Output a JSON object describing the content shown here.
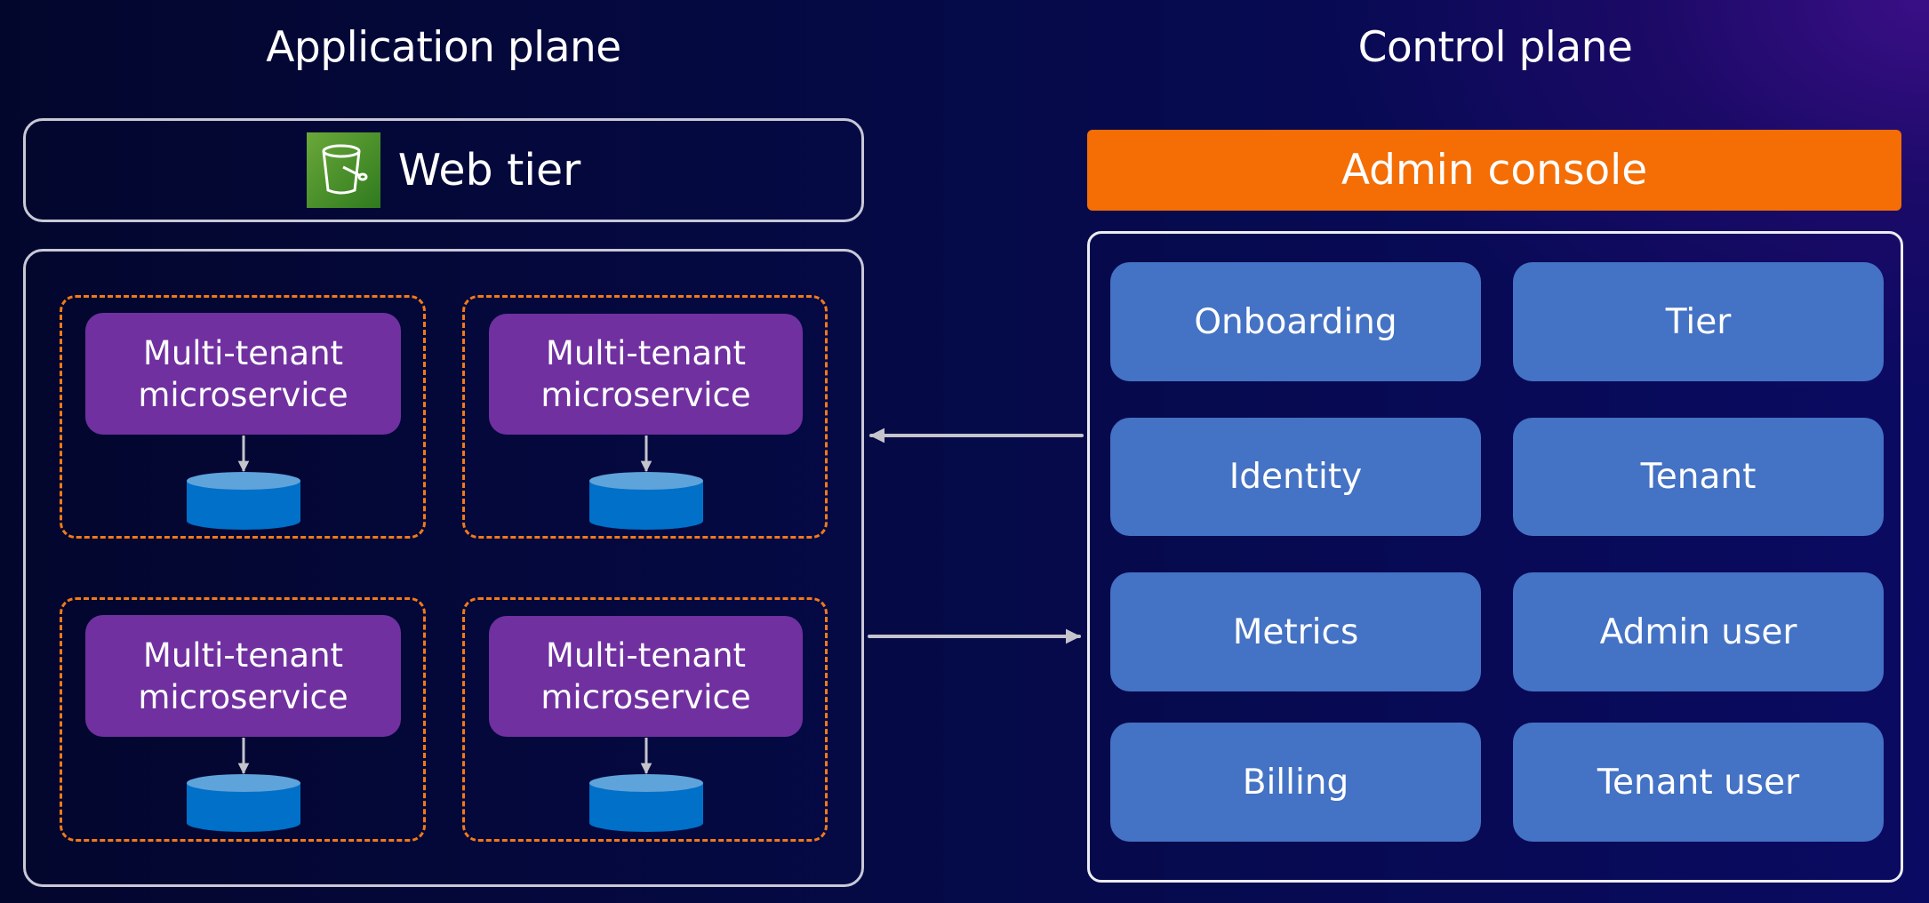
{
  "application_plane": {
    "title": "Application plane",
    "web_tier": {
      "label": "Web tier",
      "icon": "s3-bucket-icon",
      "icon_color": "#3f8624"
    },
    "microservices": [
      {
        "line1": "Multi-tenant",
        "line2": "microservice"
      },
      {
        "line1": "Multi-tenant",
        "line2": "microservice"
      },
      {
        "line1": "Multi-tenant",
        "line2": "microservice"
      },
      {
        "line1": "Multi-tenant",
        "line2": "microservice"
      }
    ],
    "colors": {
      "microservice": "#7030a0",
      "tenant_boundary": "#f07a1a",
      "database": "#0070c8"
    }
  },
  "control_plane": {
    "title": "Control plane",
    "admin_console": "Admin console",
    "services": [
      "Onboarding",
      "Tier",
      "Identity",
      "Tenant",
      "Metrics",
      "Admin user",
      "Billing",
      "Tenant user"
    ],
    "colors": {
      "admin_console": "#f46d05",
      "service": "#4472c4"
    }
  },
  "connections": [
    {
      "from": "control_plane",
      "to": "application_plane"
    },
    {
      "from": "application_plane",
      "to": "control_plane"
    }
  ]
}
